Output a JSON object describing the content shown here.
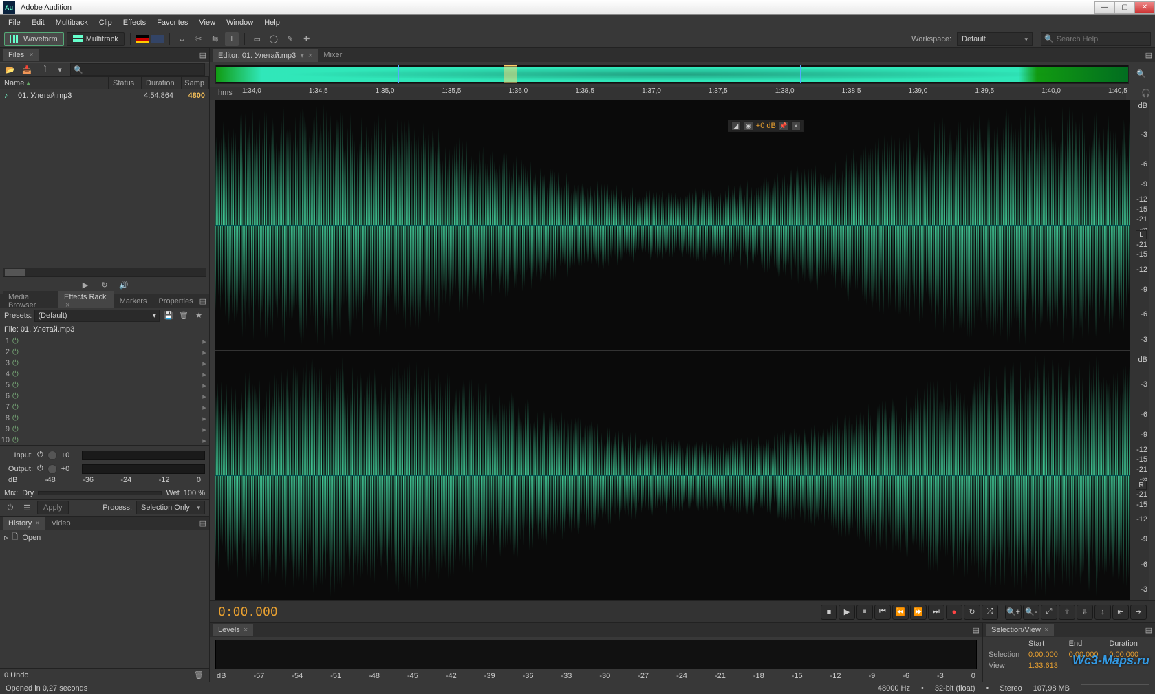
{
  "window": {
    "title": "Adobe Audition",
    "logo": "Au"
  },
  "menu": [
    "File",
    "Edit",
    "Multitrack",
    "Clip",
    "Effects",
    "Favorites",
    "View",
    "Window",
    "Help"
  ],
  "toolbar": {
    "waveform": "Waveform",
    "multitrack": "Multitrack",
    "workspace_label": "Workspace:",
    "workspace_value": "Default",
    "search_placeholder": "Search Help"
  },
  "files_panel": {
    "tab": "Files",
    "columns": {
      "name": "Name",
      "status": "Status",
      "duration": "Duration",
      "sample": "Samp"
    },
    "rows": [
      {
        "name": "01. Улетай.mp3",
        "duration": "4:54.864",
        "sample": "4800"
      }
    ]
  },
  "effects": {
    "tabs": [
      "Media Browser",
      "Effects Rack",
      "Markers",
      "Properties"
    ],
    "active_tab": 1,
    "presets_label": "Presets:",
    "preset_value": "(Default)",
    "file_label": "File: 01. Улетай.mp3",
    "slots": [
      1,
      2,
      3,
      4,
      5,
      6,
      7,
      8,
      9,
      10
    ],
    "io": {
      "input": "Input:",
      "output": "Output:",
      "gain": "+0"
    },
    "db_marks": [
      "dB",
      "-48",
      "-36",
      "-24",
      "-12",
      "0"
    ],
    "mix": {
      "label": "Mix:",
      "dry": "Dry",
      "wet": "Wet",
      "pct": "100 %"
    },
    "apply": "Apply",
    "process_label": "Process:",
    "process_value": "Selection Only"
  },
  "history": {
    "tabs": [
      "History",
      "Video"
    ],
    "items": [
      {
        "label": "Open"
      }
    ],
    "undo": "0 Undo"
  },
  "editor": {
    "tab_editor_prefix": "Editor:",
    "filename": "01. Улетай.mp3",
    "tab_mixer": "Mixer",
    "time_unit": "hms",
    "ticks": [
      "1:34,0",
      "1:34,5",
      "1:35,0",
      "1:35,5",
      "1:36,0",
      "1:36,5",
      "1:37,0",
      "1:37,5",
      "1:38,0",
      "1:38,5",
      "1:39,0",
      "1:39,5",
      "1:40,0",
      "1:40,5"
    ],
    "db_label": "dB",
    "db_marks": [
      "-3",
      "-6",
      "-9",
      "-12",
      "-15",
      "-21",
      "-∞",
      "-21",
      "-15",
      "-12",
      "-9",
      "-6",
      "-3"
    ],
    "ch_left": "L",
    "ch_right": "R",
    "hud_gain": "+0 dB",
    "timecode": "0:00.000"
  },
  "levels": {
    "tab": "Levels",
    "db_marks": [
      "dB",
      "-57",
      "-54",
      "-51",
      "-48",
      "-45",
      "-42",
      "-39",
      "-36",
      "-33",
      "-30",
      "-27",
      "-24",
      "-21",
      "-18",
      "-15",
      "-12",
      "-9",
      "-6",
      "-3",
      "0"
    ]
  },
  "selview": {
    "tab": "Selection/View",
    "headers": [
      "Start",
      "End",
      "Duration"
    ],
    "rows": [
      {
        "label": "Selection",
        "start": "0:00.000",
        "end": "0:00.000",
        "dur": "0:00.000"
      },
      {
        "label": "View",
        "start": "1:33.613",
        "end": "",
        "dur": ""
      }
    ]
  },
  "status": {
    "left": "Opened in 0,27 seconds",
    "sample_rate": "48000 Hz",
    "bit_depth": "32-bit (float)",
    "channels": "Stereo",
    "size": "107,98 MB"
  },
  "watermark": "Wc3-Maps.ru"
}
